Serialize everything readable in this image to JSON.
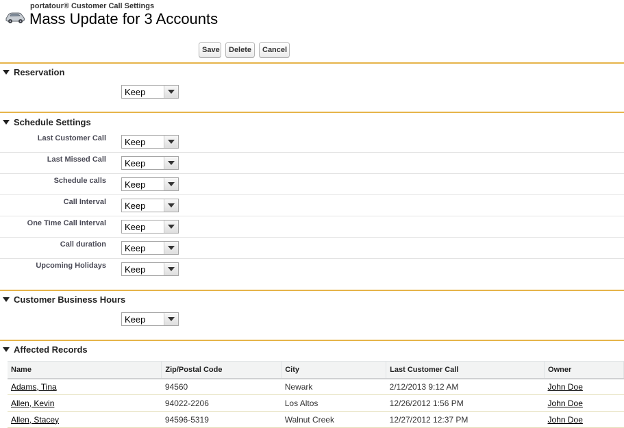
{
  "header": {
    "app_title": "portatour® Customer Call Settings",
    "page_title": "Mass Update for 3 Accounts",
    "icon": "car-icon"
  },
  "buttons": {
    "save": "Save",
    "delete": "Delete",
    "cancel": "Cancel"
  },
  "sections": {
    "reservation": {
      "title": "Reservation",
      "value": "Keep"
    },
    "schedule": {
      "title": "Schedule Settings",
      "fields": [
        {
          "label": "Last Customer Call",
          "value": "Keep"
        },
        {
          "label": "Last Missed Call",
          "value": "Keep"
        },
        {
          "label": "Schedule calls",
          "value": "Keep"
        },
        {
          "label": "Call Interval",
          "value": "Keep"
        },
        {
          "label": "One Time Call Interval",
          "value": "Keep"
        },
        {
          "label": "Call duration",
          "value": "Keep"
        },
        {
          "label": "Upcoming Holidays",
          "value": "Keep"
        }
      ]
    },
    "business_hours": {
      "title": "Customer Business Hours",
      "value": "Keep"
    },
    "affected": {
      "title": "Affected Records",
      "columns": [
        "Name",
        "Zip/Postal Code",
        "City",
        "Last Customer Call",
        "Owner"
      ],
      "rows": [
        {
          "name": "Adams, Tina",
          "zip": "94560",
          "city": "Newark",
          "last_call": "2/12/2013 9:12 AM",
          "owner": "John Doe"
        },
        {
          "name": "Allen, Kevin",
          "zip": "94022-2206",
          "city": "Los Altos",
          "last_call": "12/26/2012 1:56 PM",
          "owner": "John Doe"
        },
        {
          "name": "Allen, Stacey",
          "zip": "94596-5319",
          "city": "Walnut Creek",
          "last_call": "12/27/2012 12:37 PM",
          "owner": "John Doe"
        }
      ]
    }
  },
  "colors": {
    "section_rule": "#e6b44a",
    "row_border": "#e3deb8"
  }
}
